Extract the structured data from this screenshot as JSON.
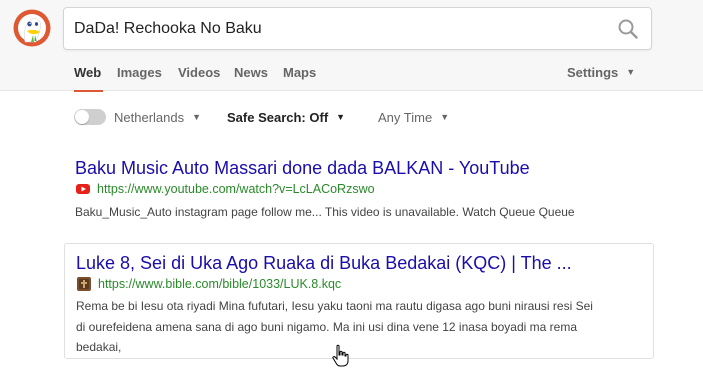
{
  "search": {
    "query": "DaDa! Rechooka No Baku"
  },
  "nav": {
    "tabs": [
      "Web",
      "Images",
      "Videos",
      "News",
      "Maps"
    ],
    "active_tab": "Web",
    "settings_label": "Settings"
  },
  "filters": {
    "region": "Netherlands",
    "safe_search": "Safe Search: Off",
    "time": "Any Time"
  },
  "results": [
    {
      "title": "Baku Music Auto Massari done dada BALKAN - YouTube",
      "url": "https://www.youtube.com/watch?v=LcLACoRzswo",
      "favicon": "youtube-icon",
      "snippet_lines": [
        "Baku_Music_Auto instagram page follow me... This video is unavailable. Watch Queue Queue"
      ]
    },
    {
      "title": "Luke 8, Sei di Uka Ago Ruaka di Buka Bedakai (KQC) | The ...",
      "url": "https://www.bible.com/bible/1033/LUK.8.kqc",
      "favicon": "bible-icon",
      "snippet_lines": [
        "Rema be bi Iesu ota riyadi Mina fufutari, Iesu yaku taoni ma rautu digasa ago buni nirausi resi Sei",
        "di ourefeidena amena sana di ago buni nigamo. Ma ini usi dina vene 12 inasa boyadi ma rema",
        "bedakai,"
      ]
    }
  ],
  "colors": {
    "accent": "#de5833",
    "link": "#1a0dab",
    "url": "#2a8a2a"
  }
}
